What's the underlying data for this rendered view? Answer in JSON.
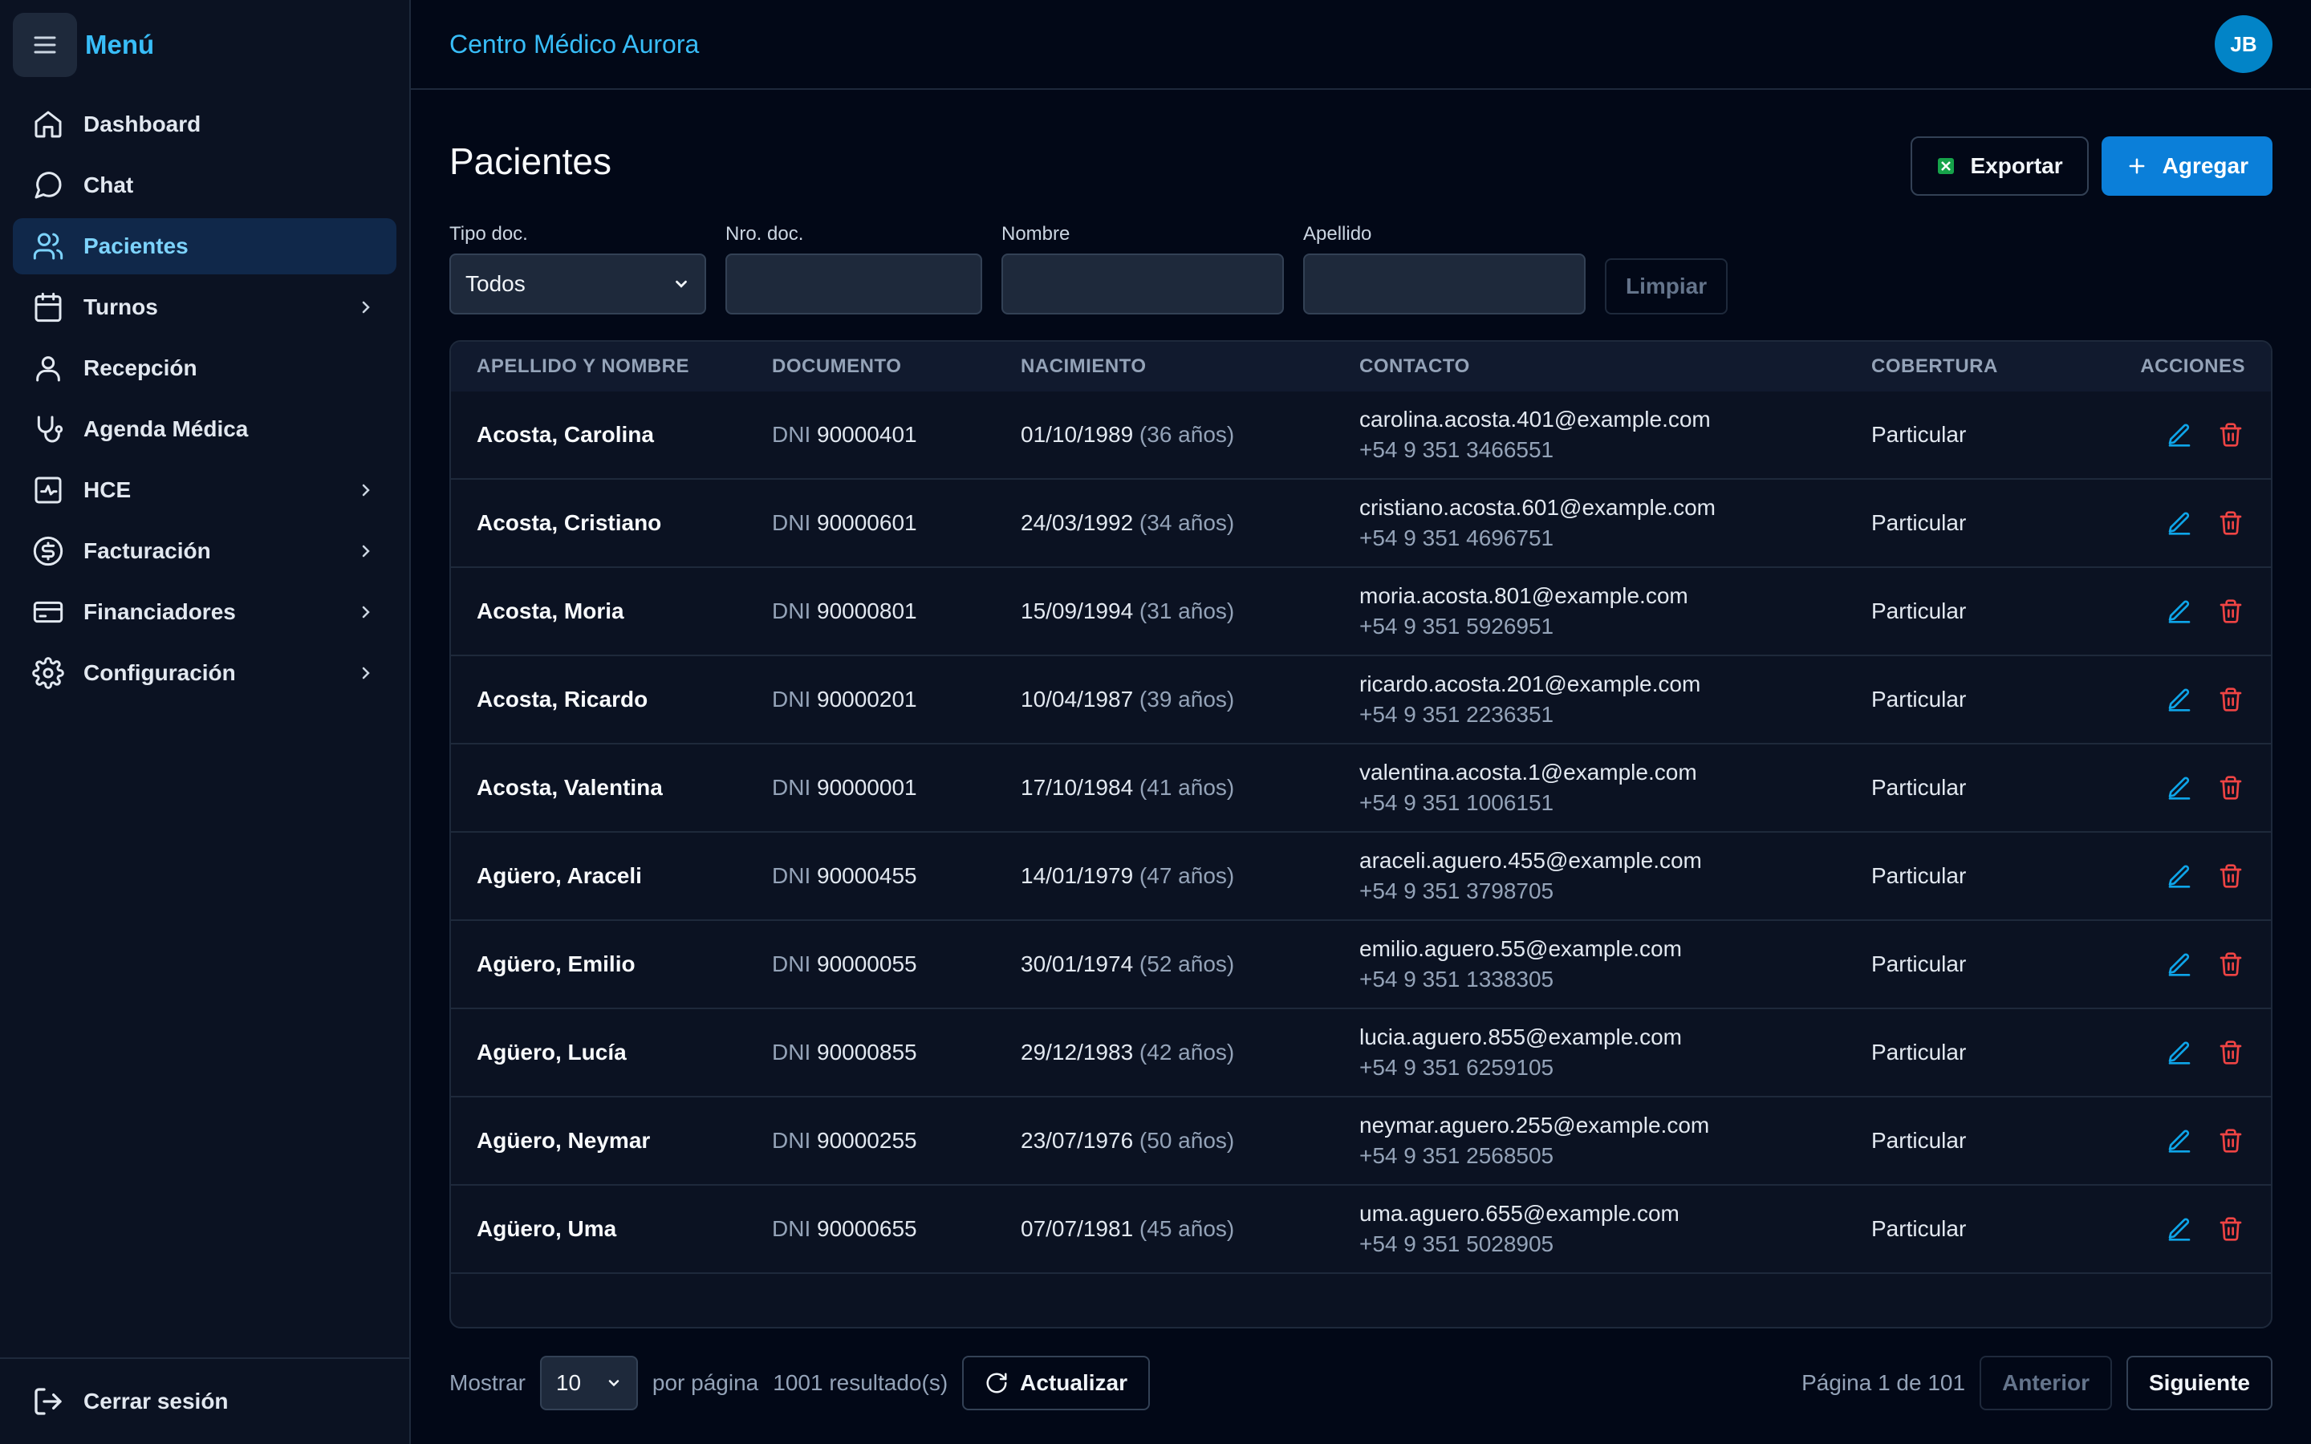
{
  "sidebar": {
    "title": "Menú",
    "items": [
      {
        "label": "Dashboard",
        "icon": "home-icon"
      },
      {
        "label": "Chat",
        "icon": "chat-icon"
      },
      {
        "label": "Pacientes",
        "icon": "users-icon",
        "active": true
      },
      {
        "label": "Turnos",
        "icon": "calendar-icon",
        "expandable": true
      },
      {
        "label": "Recepción",
        "icon": "user-icon"
      },
      {
        "label": "Agenda Médica",
        "icon": "stethoscope-icon"
      },
      {
        "label": "HCE",
        "icon": "heart-pulse-icon",
        "expandable": true
      },
      {
        "label": "Facturación",
        "icon": "dollar-icon",
        "expandable": true
      },
      {
        "label": "Financiadores",
        "icon": "credit-card-icon",
        "expandable": true
      },
      {
        "label": "Configuración",
        "icon": "gear-icon",
        "expandable": true
      }
    ],
    "logout": "Cerrar sesión"
  },
  "topbar": {
    "brand": "Centro Médico Aurora",
    "avatar_initials": "JB"
  },
  "page": {
    "title": "Pacientes",
    "export_label": "Exportar",
    "add_label": "Agregar"
  },
  "filters": {
    "tipo_doc_label": "Tipo doc.",
    "tipo_doc_value": "Todos",
    "nro_doc_label": "Nro. doc.",
    "nombre_label": "Nombre",
    "apellido_label": "Apellido",
    "clear_label": "Limpiar"
  },
  "table": {
    "headers": [
      "APELLIDO Y NOMBRE",
      "DOCUMENTO",
      "NACIMIENTO",
      "CONTACTO",
      "COBERTURA",
      "ACCIONES"
    ],
    "rows": [
      {
        "name": "Acosta, Carolina",
        "doc_type": "DNI",
        "doc": "90000401",
        "birth": "01/10/1989",
        "age": "(36 años)",
        "email": "carolina.acosta.401@example.com",
        "phone": "+54 9 351 3466551",
        "coverage": "Particular"
      },
      {
        "name": "Acosta, Cristiano",
        "doc_type": "DNI",
        "doc": "90000601",
        "birth": "24/03/1992",
        "age": "(34 años)",
        "email": "cristiano.acosta.601@example.com",
        "phone": "+54 9 351 4696751",
        "coverage": "Particular"
      },
      {
        "name": "Acosta, Moria",
        "doc_type": "DNI",
        "doc": "90000801",
        "birth": "15/09/1994",
        "age": "(31 años)",
        "email": "moria.acosta.801@example.com",
        "phone": "+54 9 351 5926951",
        "coverage": "Particular"
      },
      {
        "name": "Acosta, Ricardo",
        "doc_type": "DNI",
        "doc": "90000201",
        "birth": "10/04/1987",
        "age": "(39 años)",
        "email": "ricardo.acosta.201@example.com",
        "phone": "+54 9 351 2236351",
        "coverage": "Particular"
      },
      {
        "name": "Acosta, Valentina",
        "doc_type": "DNI",
        "doc": "90000001",
        "birth": "17/10/1984",
        "age": "(41 años)",
        "email": "valentina.acosta.1@example.com",
        "phone": "+54 9 351 1006151",
        "coverage": "Particular"
      },
      {
        "name": "Agüero, Araceli",
        "doc_type": "DNI",
        "doc": "90000455",
        "birth": "14/01/1979",
        "age": "(47 años)",
        "email": "araceli.aguero.455@example.com",
        "phone": "+54 9 351 3798705",
        "coverage": "Particular"
      },
      {
        "name": "Agüero, Emilio",
        "doc_type": "DNI",
        "doc": "90000055",
        "birth": "30/01/1974",
        "age": "(52 años)",
        "email": "emilio.aguero.55@example.com",
        "phone": "+54 9 351 1338305",
        "coverage": "Particular"
      },
      {
        "name": "Agüero, Lucía",
        "doc_type": "DNI",
        "doc": "90000855",
        "birth": "29/12/1983",
        "age": "(42 años)",
        "email": "lucia.aguero.855@example.com",
        "phone": "+54 9 351 6259105",
        "coverage": "Particular"
      },
      {
        "name": "Agüero, Neymar",
        "doc_type": "DNI",
        "doc": "90000255",
        "birth": "23/07/1976",
        "age": "(50 años)",
        "email": "neymar.aguero.255@example.com",
        "phone": "+54 9 351 2568505",
        "coverage": "Particular"
      },
      {
        "name": "Agüero, Uma",
        "doc_type": "DNI",
        "doc": "90000655",
        "birth": "07/07/1981",
        "age": "(45 años)",
        "email": "uma.aguero.655@example.com",
        "phone": "+54 9 351 5028905",
        "coverage": "Particular"
      }
    ]
  },
  "pager": {
    "show_label": "Mostrar",
    "per_page_value": "10",
    "per_page_label": "por página",
    "results": "1001 resultado(s)",
    "refresh_label": "Actualizar",
    "page_info": "Página 1 de 101",
    "prev_label": "Anterior",
    "next_label": "Siguiente"
  },
  "colors": {
    "accent": "#0b7fd9",
    "brand": "#38bdf8",
    "danger": "#ef4444",
    "background": "#020817"
  }
}
